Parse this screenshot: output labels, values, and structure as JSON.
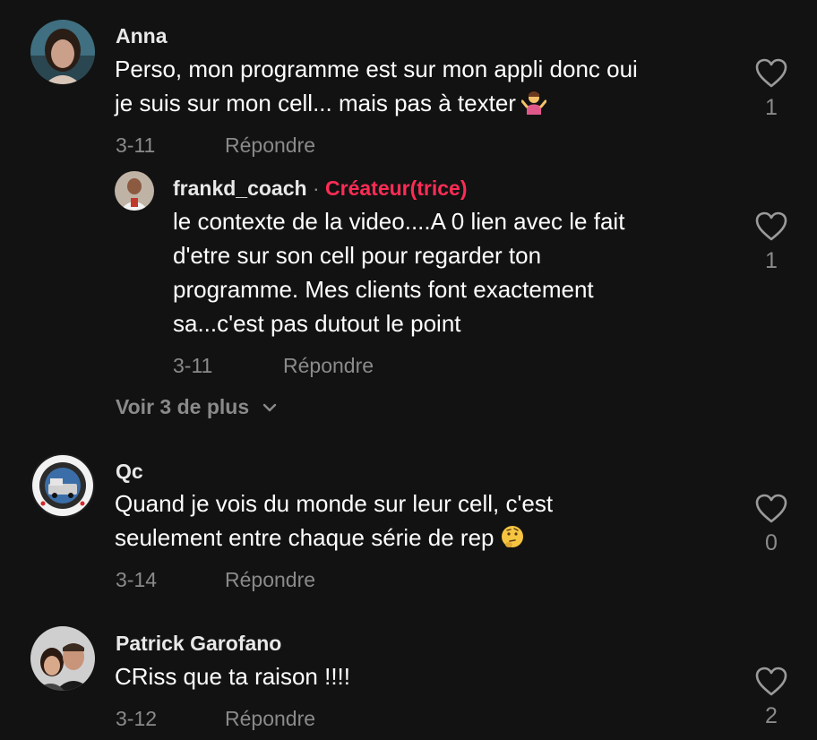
{
  "comments": [
    {
      "username": "Anna",
      "lines": [
        "Perso, mon programme est sur mon appli donc oui",
        "je suis sur mon cell... mais pas à texter"
      ],
      "emoji": "person-shrugging",
      "date": "3-11",
      "reply_label": "Répondre",
      "likes": "1",
      "replies": [
        {
          "username": "frankd_coach",
          "separator": "·",
          "badge": "Créateur(trice)",
          "lines": [
            "le contexte de la video....A 0 lien avec le fait",
            "d'etre sur son cell pour regarder ton",
            "programme. Mes clients font exactement",
            "sa...c'est pas dutout le point"
          ],
          "date": "3-11",
          "reply_label": "Répondre",
          "likes": "1"
        }
      ],
      "view_more_label": "Voir 3 de plus"
    },
    {
      "username": "Qc",
      "lines": [
        "Quand je vois du monde sur leur cell, c'est",
        "seulement entre chaque série de rep"
      ],
      "emoji": "thinking-face",
      "date": "3-14",
      "reply_label": "Répondre",
      "likes": "0"
    },
    {
      "username": "Patrick Garofano",
      "lines": [
        "CRiss que ta raison !!!!"
      ],
      "date": "3-12",
      "reply_label": "Répondre",
      "likes": "2"
    }
  ],
  "colors": {
    "background": "#121212",
    "text": "#ffffff",
    "muted": "#8a8a8a",
    "creator_badge": "#fe2c55"
  },
  "icons": {
    "like": "heart-outline-icon",
    "expand": "chevron-down-icon"
  }
}
